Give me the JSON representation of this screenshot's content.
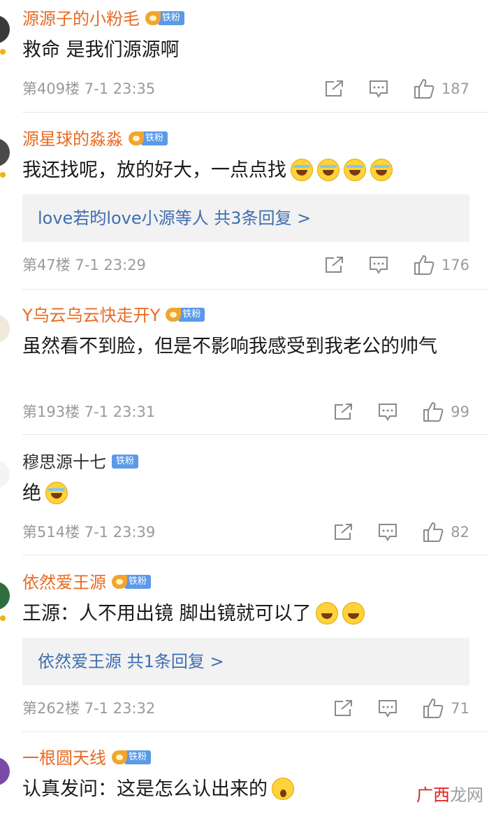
{
  "comments": [
    {
      "username": "源源子的小粉毛",
      "fan_badge": "铁粉",
      "content": "救命  是我们源源啊",
      "floor": "第409楼",
      "time": "7-1 23:35",
      "likes": "187"
    },
    {
      "username": "源星球的淼淼",
      "fan_badge": "铁粉",
      "content": "我还找呢，放的好大，一点点找",
      "replies": "love若昀love小源等人  共3条回复 >",
      "floor": "第47楼",
      "time": "7-1 23:29",
      "likes": "176"
    },
    {
      "username": "Y乌云乌云快走开Y",
      "fan_badge": "铁粉",
      "content": "虽然看不到脸，但是不影响我感受到我老公的帅气",
      "floor": "第193楼",
      "time": "7-1 23:31",
      "likes": "99"
    },
    {
      "username": "穆思源十七",
      "fan_badge": "铁粉",
      "content": "绝",
      "floor": "第514楼",
      "time": "7-1 23:39",
      "likes": "82"
    },
    {
      "username": "依然爱王源",
      "fan_badge": "铁粉",
      "content": "王源：人不用出镜 脚出镜就可以了",
      "replies": "依然爱王源  共1条回复 >",
      "floor": "第262楼",
      "time": "7-1 23:32",
      "likes": "71"
    },
    {
      "username": "一根圆天线",
      "fan_badge": "铁粉",
      "content": "认真发问：这是怎么认出来的"
    }
  ],
  "icons": {
    "share": "share-icon",
    "comment": "comment-icon",
    "like": "thumbs-up-icon"
  },
  "watermark": {
    "part1": "广西",
    "part2": "龙网"
  },
  "colors": {
    "username_vip": "#e86a22",
    "reply_link": "#3e6fb0",
    "meta_text": "#9a9a9a",
    "fan_tag": "#5a9ae8"
  }
}
